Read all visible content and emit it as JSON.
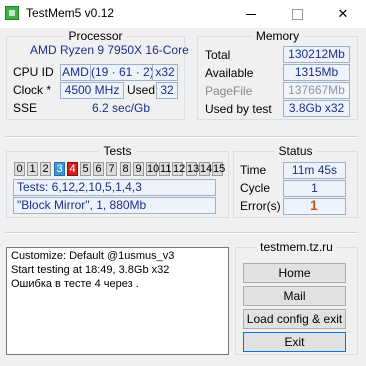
{
  "window": {
    "title": "TestMem5 v0.12"
  },
  "processor": {
    "title": "Processor",
    "name": "AMD Ryzen 9 7950X 16-Core",
    "cpu_id_label": "CPU ID",
    "cpu_vendor": "AMD",
    "cpu_id": "(19 · 61 · 2)",
    "cpu_arch": "x32",
    "clock_label": "Clock *",
    "clock": "4500 MHz",
    "used_label": "Used",
    "used": "32",
    "sse_label": "SSE",
    "sse": "6.2 sec/Gb"
  },
  "memory": {
    "title": "Memory",
    "total_label": "Total",
    "total": "130212Mb",
    "available_label": "Available",
    "available": "1315Mb",
    "pagefile_label": "PageFile",
    "pagefile": "137667Mb",
    "used_by_test_label": "Used by test",
    "used_by_test": "3.8Gb x32"
  },
  "tests": {
    "title": "Tests",
    "cells": [
      {
        "label": "0",
        "state": "normal"
      },
      {
        "label": "1",
        "state": "normal"
      },
      {
        "label": "2",
        "state": "normal"
      },
      {
        "label": "3",
        "state": "done"
      },
      {
        "label": "4",
        "state": "active"
      },
      {
        "label": "5",
        "state": "normal"
      },
      {
        "label": "6",
        "state": "normal"
      },
      {
        "label": "7",
        "state": "normal"
      },
      {
        "label": "8",
        "state": "normal"
      },
      {
        "label": "9",
        "state": "normal"
      },
      {
        "label": "10",
        "state": "normal"
      },
      {
        "label": "11",
        "state": "normal"
      },
      {
        "label": "12",
        "state": "normal"
      },
      {
        "label": "13",
        "state": "normal"
      },
      {
        "label": "14",
        "state": "normal"
      },
      {
        "label": "15",
        "state": "normal"
      }
    ],
    "sequence": "Tests: 6,12,2,10,5,1,4,3",
    "current": "\"Block Mirror\", 1, 880Mb"
  },
  "status": {
    "title": "Status",
    "time_label": "Time",
    "time": "11m 45s",
    "cycle_label": "Cycle",
    "cycle": "1",
    "errors_label": "Error(s)",
    "errors": "1"
  },
  "log": {
    "lines": [
      "Customize: Default @1usmus_v3",
      "Start testing at 18:49, 3.8Gb x32",
      "Ошибка в тесте 4 через ."
    ]
  },
  "site": "testmem.tz.ru",
  "buttons": {
    "home": "Home",
    "mail": "Mail",
    "load": "Load config & exit",
    "exit": "Exit"
  },
  "colors": {
    "accent_done": "#3a96d8",
    "error": "#d81f1f",
    "field_text": "#1a2f8a"
  }
}
